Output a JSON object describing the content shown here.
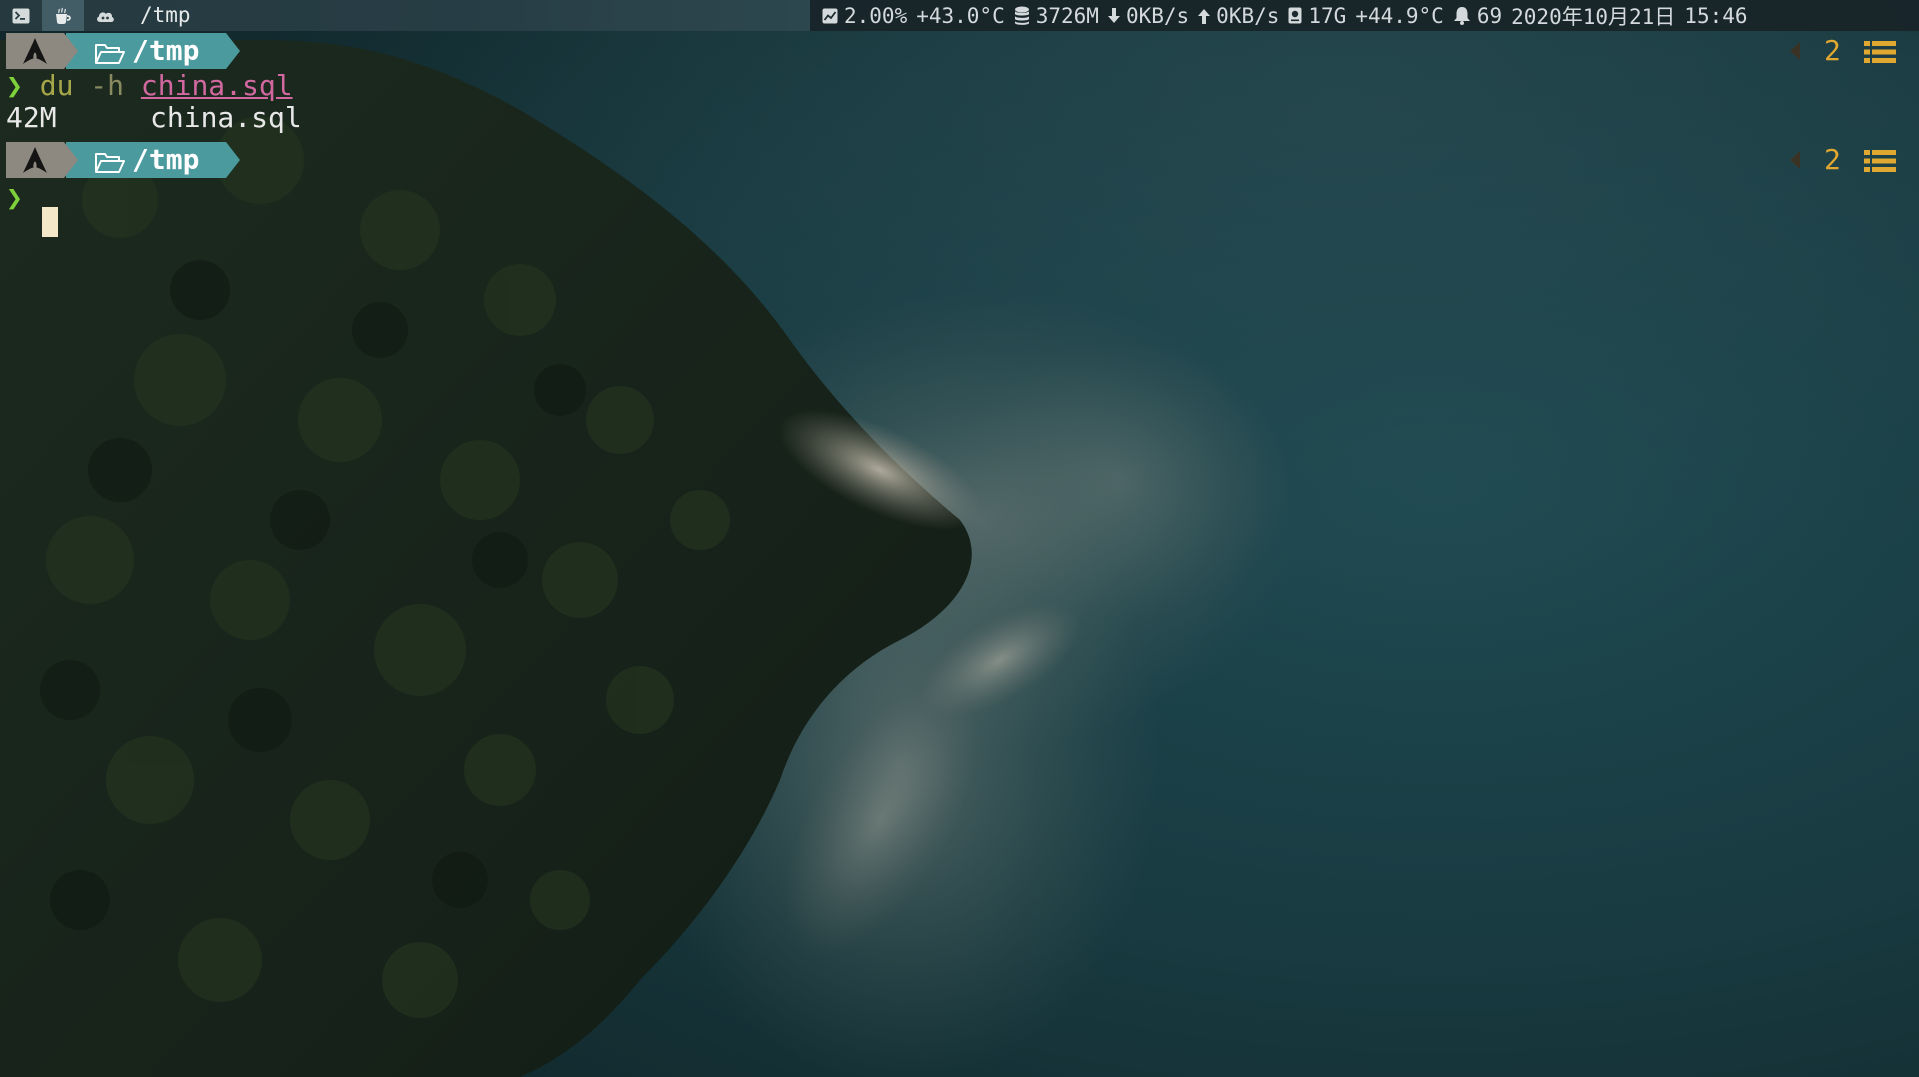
{
  "topbar": {
    "workspaces": [
      {
        "icon": "terminal-icon"
      },
      {
        "icon": "coffee-icon",
        "active": true
      },
      {
        "icon": "cloud-icon"
      }
    ],
    "window_title": "/tmp",
    "sysinfo": {
      "cpu_icon": "cpu-chart-icon",
      "cpu_usage": "2.00%",
      "cpu_temp": "+43.0°C",
      "memory_icon": "database-icon",
      "memory": "3726M",
      "download_icon": "arrow-down-icon",
      "download_speed": "0KB/s",
      "upload_icon": "arrow-up-icon",
      "upload_speed": "0KB/s",
      "disk_icon": "drive-icon",
      "disk_free": "17G",
      "disk_temp": "+44.9°C",
      "notification_icon": "bell-icon",
      "notifications": "69",
      "date": "2020年10月21日",
      "time": "15:46"
    }
  },
  "terminal": {
    "blocks": [
      {
        "prompt": {
          "os_icon": "arch-linux-icon",
          "dir_icon": "folder-open-icon",
          "dir": "/tmp",
          "right_count": "2",
          "right_icon": "list-icon"
        },
        "command": {
          "chevron": "❯",
          "cmd": "du",
          "flag": "-h",
          "file": "china.sql"
        },
        "output": {
          "size": "42M",
          "name": "china.sql"
        }
      },
      {
        "prompt": {
          "os_icon": "arch-linux-icon",
          "dir_icon": "folder-open-icon",
          "dir": "/tmp",
          "right_count": "2",
          "right_icon": "list-icon"
        },
        "command": {
          "chevron": "❯"
        }
      }
    ]
  },
  "colors": {
    "os_segment": "#8d8880",
    "dir_segment": "#4a9a9e",
    "prompt_chevron": "#7fd13b",
    "command": "#a6a64a",
    "filename_arg": "#d268a0",
    "right_prompt_accent": "#e0a830",
    "cursor": "#f3e9c9"
  }
}
